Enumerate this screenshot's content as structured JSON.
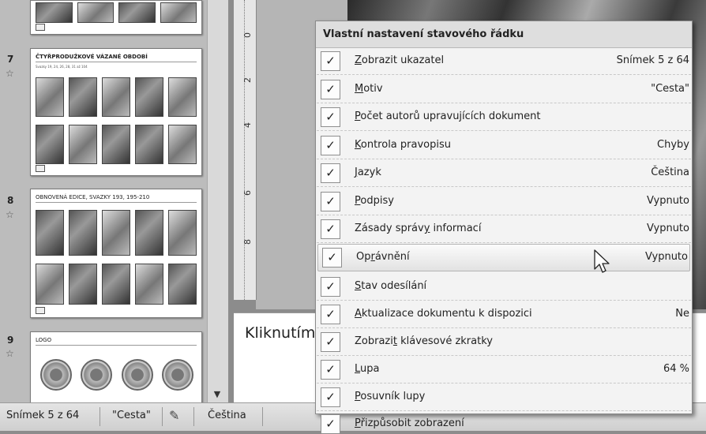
{
  "thumbnails": {
    "slide7": {
      "number": "7",
      "title": "ČTYŘPRODUŽKOVÉ VÁZANÉ OBDOBÍ",
      "subtitle": "Svazky 19, 24, 26, 28, 31 až 104"
    },
    "slide8": {
      "number": "8",
      "title": "OBNOVENÁ EDICE, SVAZKY 193, 195-210"
    },
    "slide9": {
      "number": "9",
      "title": "LOGO"
    }
  },
  "ruler": {
    "ticks": [
      "0",
      "2",
      "4",
      "6",
      "8"
    ]
  },
  "notes": {
    "text": "Kliknutím"
  },
  "statusbar": {
    "slide": "Snímek 5 z 64",
    "theme": "\"Cesta\"",
    "language": "Čeština"
  },
  "context_menu": {
    "title": "Vlastní nastavení stavového řádku",
    "items": [
      {
        "pre": "",
        "key": "Z",
        "post": "obrazit ukazatel",
        "value": "Snímek 5 z 64",
        "checked": true
      },
      {
        "pre": "",
        "key": "M",
        "post": "otiv",
        "value": "\"Cesta\"",
        "checked": true
      },
      {
        "pre": "",
        "key": "P",
        "post": "očet autorů upravujících dokument",
        "value": "",
        "checked": true
      },
      {
        "pre": "",
        "key": "K",
        "post": "ontrola pravopisu",
        "value": "Chyby",
        "checked": true
      },
      {
        "pre": "",
        "key": "J",
        "post": "azyk",
        "value": "Čeština",
        "checked": true
      },
      {
        "pre": "",
        "key": "P",
        "post": "odpisy",
        "value": "Vypnuto",
        "checked": true
      },
      {
        "pre": "Zásady správ",
        "key": "y",
        "post": " informací",
        "value": "Vypnuto",
        "checked": true
      },
      {
        "pre": "Op",
        "key": "r",
        "post": "ávnění",
        "value": "Vypnuto",
        "checked": true
      },
      {
        "pre": "",
        "key": "S",
        "post": "tav odesílání",
        "value": "",
        "checked": true
      },
      {
        "pre": "",
        "key": "A",
        "post": "ktualizace dokumentu k dispozici",
        "value": "Ne",
        "checked": true
      },
      {
        "pre": "Zobrazi",
        "key": "t",
        "post": " klávesové zkratky",
        "value": "",
        "checked": true
      },
      {
        "pre": "",
        "key": "L",
        "post": "upa",
        "value": "64 %",
        "checked": true
      },
      {
        "pre": "",
        "key": "P",
        "post": "osuvník lupy",
        "value": "",
        "checked": true
      },
      {
        "pre": "",
        "key": "P",
        "post": "řizpůsobit zobrazení",
        "value": "",
        "checked": true
      }
    ],
    "highlighted_index": 7,
    "check_glyph": "✓"
  }
}
